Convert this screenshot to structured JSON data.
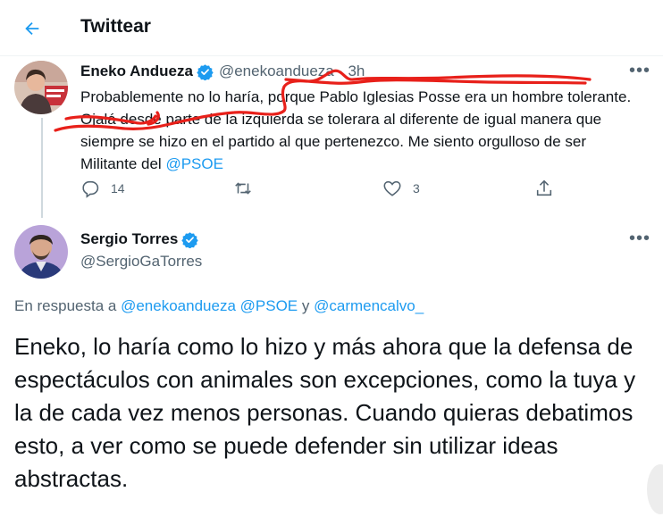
{
  "header": {
    "title": "Twittear",
    "back_icon": "arrow-left-icon",
    "accent": "#1d9bf0"
  },
  "tweet1": {
    "name": "Eneko Andueza",
    "handle": "@enekoandueza",
    "separator": "·",
    "time": "3h",
    "text_before_mention": "Probablemente no lo haría, porque Pablo Iglesias Posse era un hombre tolerante. Ojalá desde parte de la izquierda se tolerara al diferente de igual manera que siempre se hizo en el partido al que pertenezco. Me siento orgulloso de ser Militante del ",
    "mention": "@PSOE",
    "more": "•••",
    "actions": {
      "reply_count": "14",
      "retweet_count": "",
      "like_count": "3"
    }
  },
  "tweet2": {
    "name": "Sergio Torres",
    "handle": "@SergioGaTorres",
    "more": "•••",
    "reply_prefix": "En respuesta a",
    "reply_mentions": [
      "@enekoandueza",
      "@PSOE",
      "@carmencalvo_"
    ],
    "reply_conjunction": "y",
    "text": "Eneko, lo haría como lo hizo y más ahora que la defensa de espectáculos con animales son excepciones, como la tuya y la de cada vez menos personas. Cuando quieras debatimos esto, a ver como se puede defender sin utilizar ideas abstractas."
  },
  "colors": {
    "annotation": "#e8201a",
    "secondary_text": "#536471",
    "link": "#1d9bf0"
  }
}
